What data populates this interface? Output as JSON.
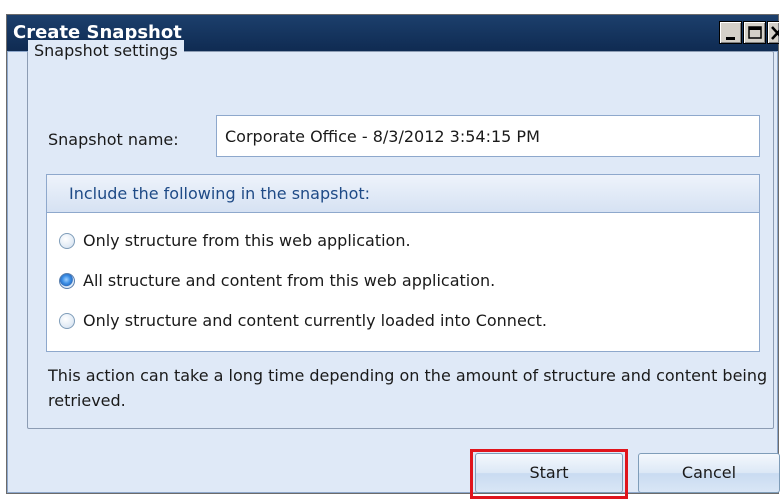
{
  "window": {
    "title": "Create Snapshot",
    "controls": [
      "minimize-icon",
      "maximize-icon",
      "close-icon"
    ]
  },
  "settings": {
    "group_label": "Snapshot settings",
    "name_label": "Snapshot name:",
    "name_value": "Corporate Office - 8/3/2012 3:54:15 PM"
  },
  "include": {
    "header": "Include the following in the snapshot:",
    "options": [
      {
        "label": "Only structure from this web application.",
        "checked": false
      },
      {
        "label": "All structure and content from this web application.",
        "checked": true
      },
      {
        "label": "Only structure and content currently loaded into Connect.",
        "checked": false
      }
    ]
  },
  "info": "This action can take a long time depending on the amount of structure and content being retrieved.",
  "buttons": {
    "start": "Start",
    "cancel": "Cancel"
  },
  "colors": {
    "titlebar": "#0f2b52",
    "client_background": "#dfe9f7",
    "highlight": "#e0141c"
  }
}
